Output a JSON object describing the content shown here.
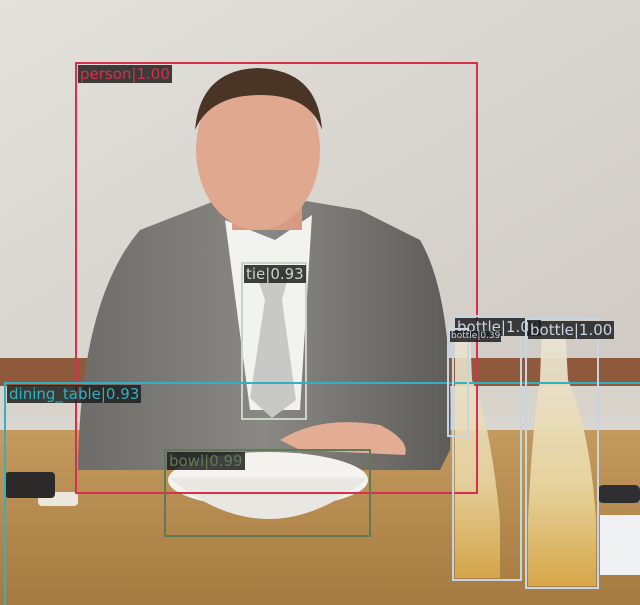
{
  "palette": {
    "person": "#d6304f",
    "tie": "#c9d4c6",
    "bottle": "#c5d5e3",
    "dining_table": "#2fb3c2",
    "bowl": "#5f7a56"
  },
  "detections": [
    {
      "id": "person",
      "label": "person|1.00",
      "category": "person"
    },
    {
      "id": "tie",
      "label": "tie|0.93",
      "category": "tie"
    },
    {
      "id": "bottle-1",
      "label": "bottle|1.00",
      "category": "bottle"
    },
    {
      "id": "bottle-2",
      "label": "bottle|0.39",
      "category": "bottle"
    },
    {
      "id": "bottle-3",
      "label": "bottle|1.00",
      "category": "bottle"
    },
    {
      "id": "dining-table",
      "label": "dining_table|0.93",
      "category": "dining_table"
    },
    {
      "id": "bowl",
      "label": "bowl|0.99",
      "category": "bowl"
    }
  ]
}
